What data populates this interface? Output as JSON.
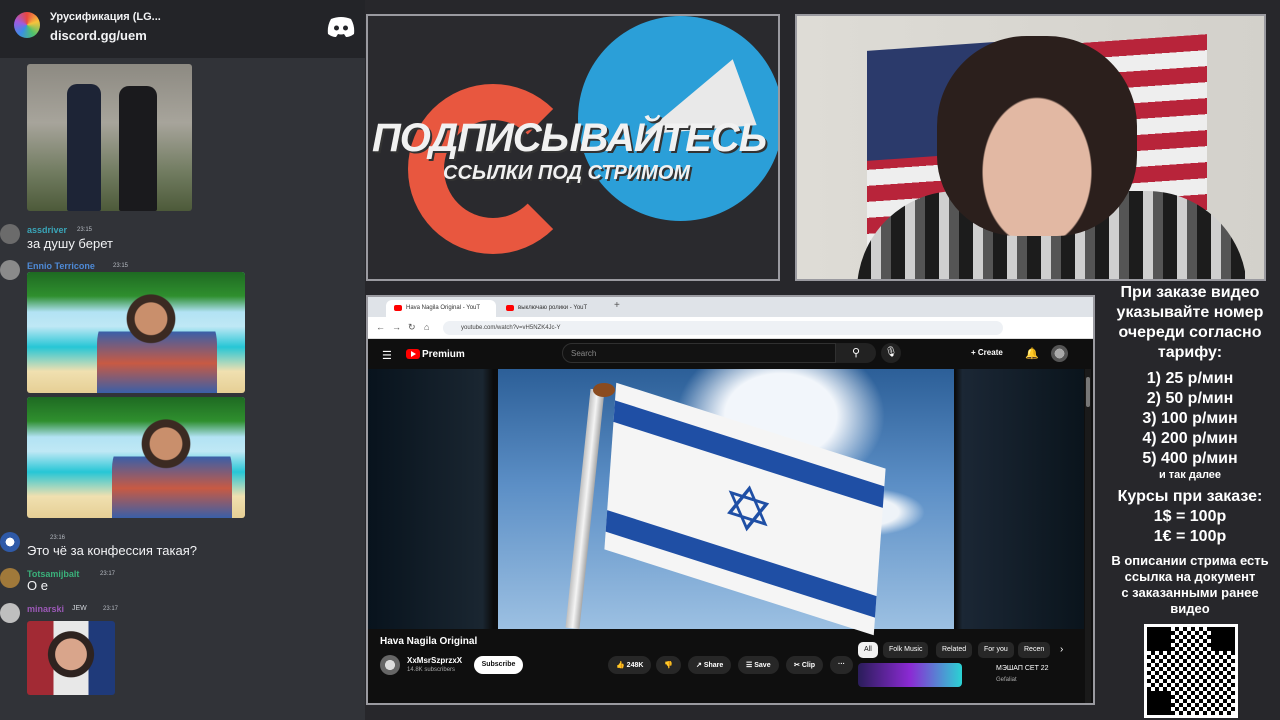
{
  "discord": {
    "server_name": "Урусификация (LG...",
    "server_link": "discord.gg/uem",
    "logo_icon": "discord-icon",
    "messages": [
      {
        "author": "assdriver",
        "author_color": "#3aa5b8",
        "time": "23:15",
        "text": "за душу берет"
      },
      {
        "author": "Ennio Terricone",
        "author_color": "#4e8ad6",
        "time": "23:15",
        "text": ""
      },
      {
        "author": "",
        "author_color": "#b5bac1",
        "time": "23:16",
        "text": "Это чё за конфессия такая?"
      },
      {
        "author": "Totsamijbalt",
        "author_color": "#3ab07a",
        "time": "23:17",
        "text": "О е"
      },
      {
        "author": "minarski",
        "author_color": "#9b59b6",
        "time": "23:17",
        "text": "",
        "badge": "JEW"
      }
    ]
  },
  "promo": {
    "headline": "ПОДПИСЫВАЙТЕСЬ",
    "subline": "ССЫЛКИ ПОД СТРИМОМ",
    "colors": {
      "patreon": "#e8573f",
      "telegram": "#2b9fd8"
    }
  },
  "browser": {
    "tabs": [
      {
        "label": "Hava Nagila Original - YouT",
        "active": true
      },
      {
        "label": "выключаю ролики - YouT",
        "active": false
      }
    ],
    "new_tab_label": "+",
    "nav": {
      "back": "←",
      "forward": "→",
      "reload": "↻",
      "home": "⌂"
    },
    "url": "youtube.com/watch?v=vH5NZK4Jc-Y",
    "youtube": {
      "brand": "Premium",
      "search_placeholder": "Search",
      "create_label": "Create",
      "video_title": "Hava Nagila Original",
      "channel_name": "XxMsrSzprzxX",
      "channel_subs": "14.8K subscribers",
      "subscribe_label": "Subscribe",
      "likes": "248K",
      "share_label": "Share",
      "save_label": "Save",
      "clip_label": "Clip",
      "more_label": "···",
      "chips": [
        "All",
        "Folk Music",
        "Related",
        "For you",
        "Recen"
      ],
      "recommended": {
        "title": "МЭШАП СЕТ 22",
        "channel": "Gefaliat"
      }
    }
  },
  "info_panel": {
    "intro": [
      "При заказе видео",
      "указывайте номер",
      "очереди согласно",
      "тарифу:"
    ],
    "tariffs": [
      "1) 25 р/мин",
      "2) 50 р/мин",
      "3) 100 р/мин",
      "4) 200 р/мин",
      "5) 400 р/мин"
    ],
    "etc": "и так далее",
    "rates_title": "Курсы при заказе:",
    "rates": [
      "1$ = 100р",
      "1€ = 100р"
    ],
    "footer": [
      "В описании стрима есть",
      "ссылка на документ",
      "с заказанными ранее",
      "видео"
    ]
  }
}
